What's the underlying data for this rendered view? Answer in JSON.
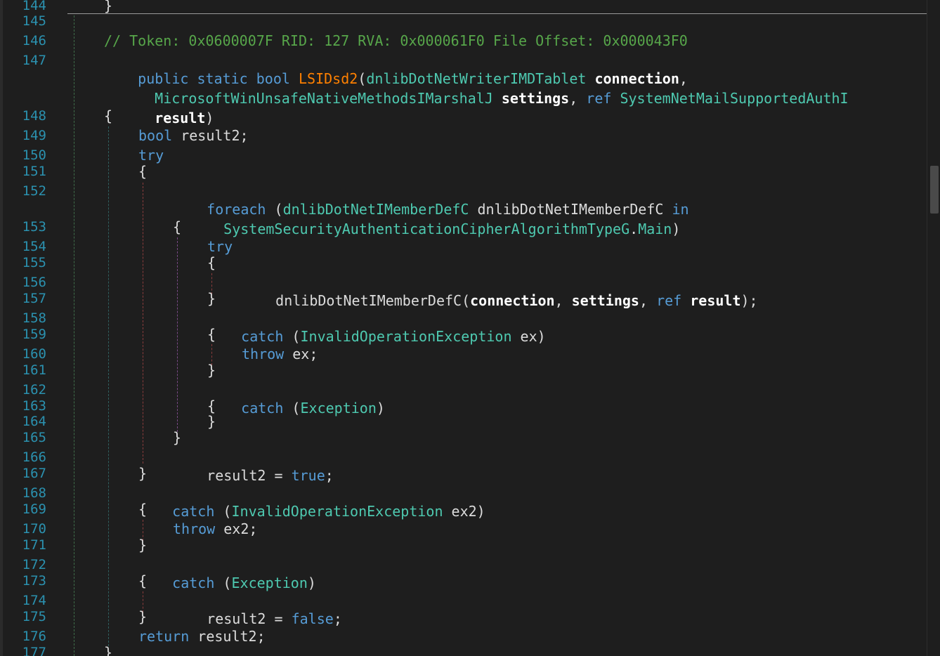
{
  "editor": {
    "line_numbers": [
      "144",
      "145",
      "146",
      "147",
      "148",
      "149",
      "150",
      "151",
      "152",
      "153",
      "154",
      "155",
      "156",
      "157",
      "158",
      "159",
      "160",
      "161",
      "162",
      "163",
      "164",
      "165",
      "166",
      "167",
      "168",
      "169",
      "170",
      "171",
      "172",
      "173",
      "174",
      "175",
      "176",
      "177"
    ],
    "colors": {
      "background": "#1e1e1e",
      "keyword": "#569cd6",
      "type": "#4ec9b0",
      "comment": "#57a64a",
      "method": "#ff8000",
      "line_number": "#2b91af",
      "text": "#dcdcdc"
    },
    "code": {
      "l144": [
        "}"
      ],
      "l146": [
        "// Token: 0x0600007F RID: 127 RVA: 0x000061F0 File Offset: 0x000043F0"
      ],
      "l147": [
        "public",
        " ",
        "static",
        " ",
        "bool",
        " ",
        "LSIDsd2",
        "(",
        "dnlibDotNetWriterIMDTablet",
        " ",
        "connection",
        ","
      ],
      "l147b": [
        "MicrosoftWinUnsafeNativeMethodsIMarshalJ",
        " ",
        "settings",
        ", ",
        "ref",
        " ",
        "SystemNetMailSupportedAuthI"
      ],
      "l147c": [
        "result",
        ")"
      ],
      "l148": [
        "{"
      ],
      "l149": [
        "bool",
        " result2;"
      ],
      "l150": [
        "try"
      ],
      "l151": [
        "{"
      ],
      "l152": [
        "foreach",
        " (",
        "dnlibDotNetIMemberDefC",
        " dnlibDotNetIMemberDefC ",
        "in"
      ],
      "l152b": [
        "SystemSecurityAuthenticationCipherAlgorithmTypeG",
        ".",
        "Main",
        ")"
      ],
      "l153": [
        "{"
      ],
      "l154": [
        "try"
      ],
      "l155": [
        "{"
      ],
      "l156": [
        "dnlibDotNetIMemberDefC(",
        "connection",
        ", ",
        "settings",
        ", ",
        "ref",
        " ",
        "result",
        ");"
      ],
      "l157": [
        "}"
      ],
      "l158": [
        "catch",
        " (",
        "InvalidOperationException",
        " ex)"
      ],
      "l159": [
        "{"
      ],
      "l160": [
        "throw",
        " ex;"
      ],
      "l161": [
        "}"
      ],
      "l162": [
        "catch",
        " (",
        "Exception",
        ")"
      ],
      "l163": [
        "{"
      ],
      "l164": [
        "}"
      ],
      "l165": [
        "}"
      ],
      "l166": [
        "result2 = ",
        "true",
        ";"
      ],
      "l167": [
        "}"
      ],
      "l168": [
        "catch",
        " (",
        "InvalidOperationException",
        " ex2)"
      ],
      "l169": [
        "{"
      ],
      "l170": [
        "throw",
        " ex2;"
      ],
      "l171": [
        "}"
      ],
      "l172": [
        "catch",
        " (",
        "Exception",
        ")"
      ],
      "l173": [
        "{"
      ],
      "l174": [
        "result2 = ",
        "false",
        ";"
      ],
      "l175": [
        "}"
      ],
      "l176": [
        "return",
        " result2;"
      ],
      "l177": [
        "}"
      ]
    }
  }
}
